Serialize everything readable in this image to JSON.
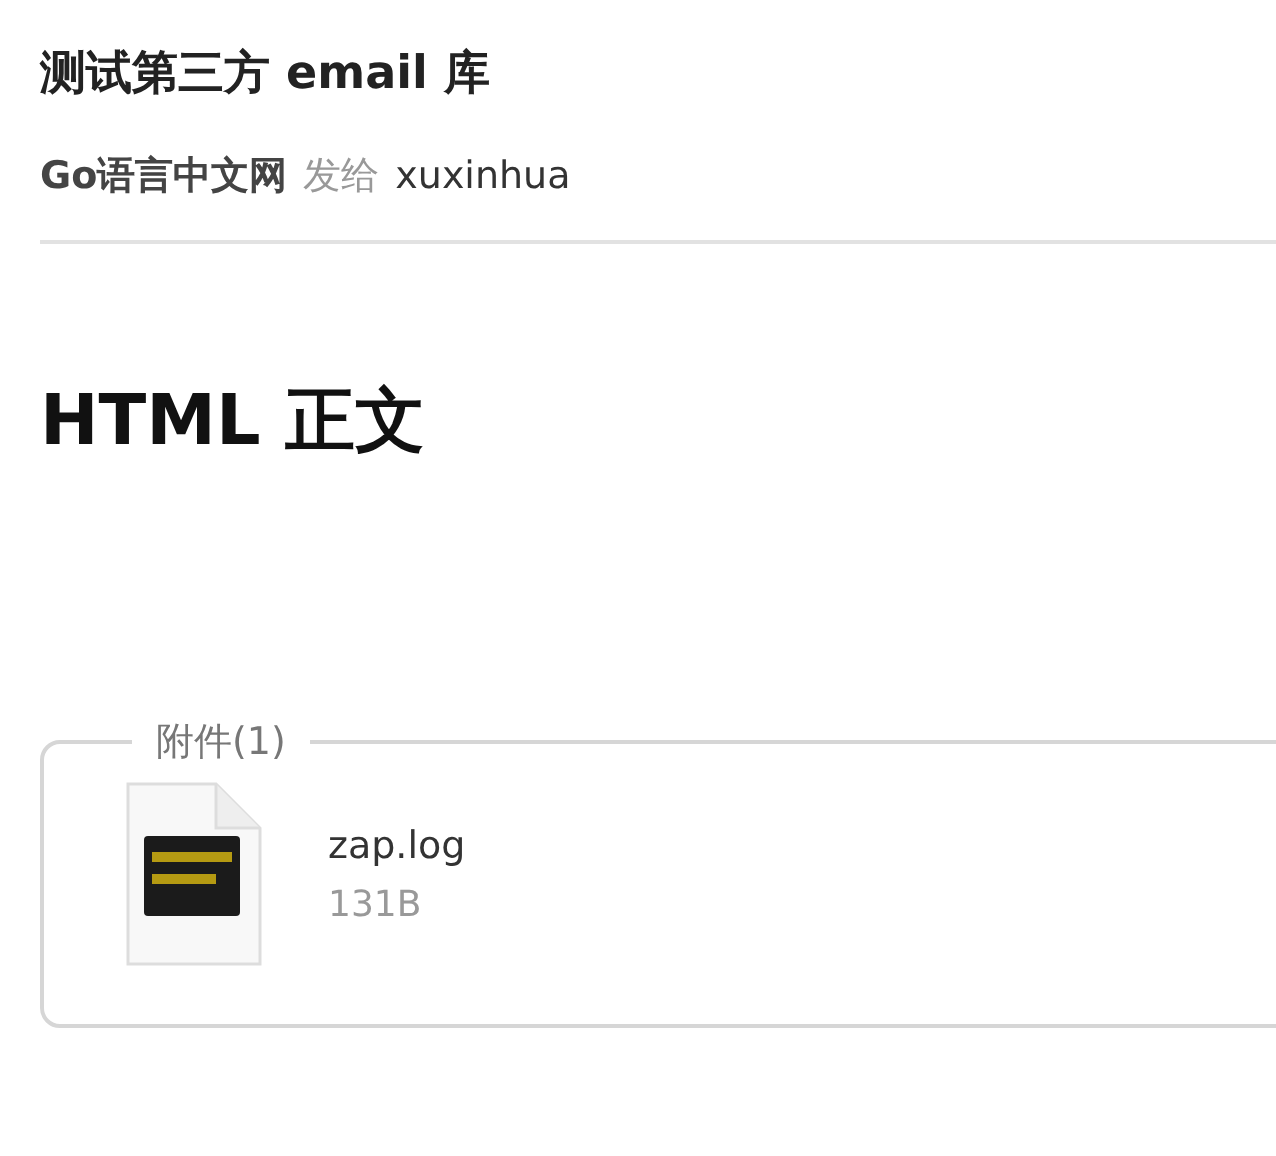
{
  "subject": "测试第三方 email 库",
  "sender": {
    "name": "Go语言中文网",
    "verb": "发给",
    "recipient": "xuxinhua"
  },
  "body": {
    "heading": "HTML 正文"
  },
  "attachments": {
    "legend": "附件(1)",
    "files": [
      {
        "name": "zap.log",
        "size": "131B"
      }
    ]
  }
}
